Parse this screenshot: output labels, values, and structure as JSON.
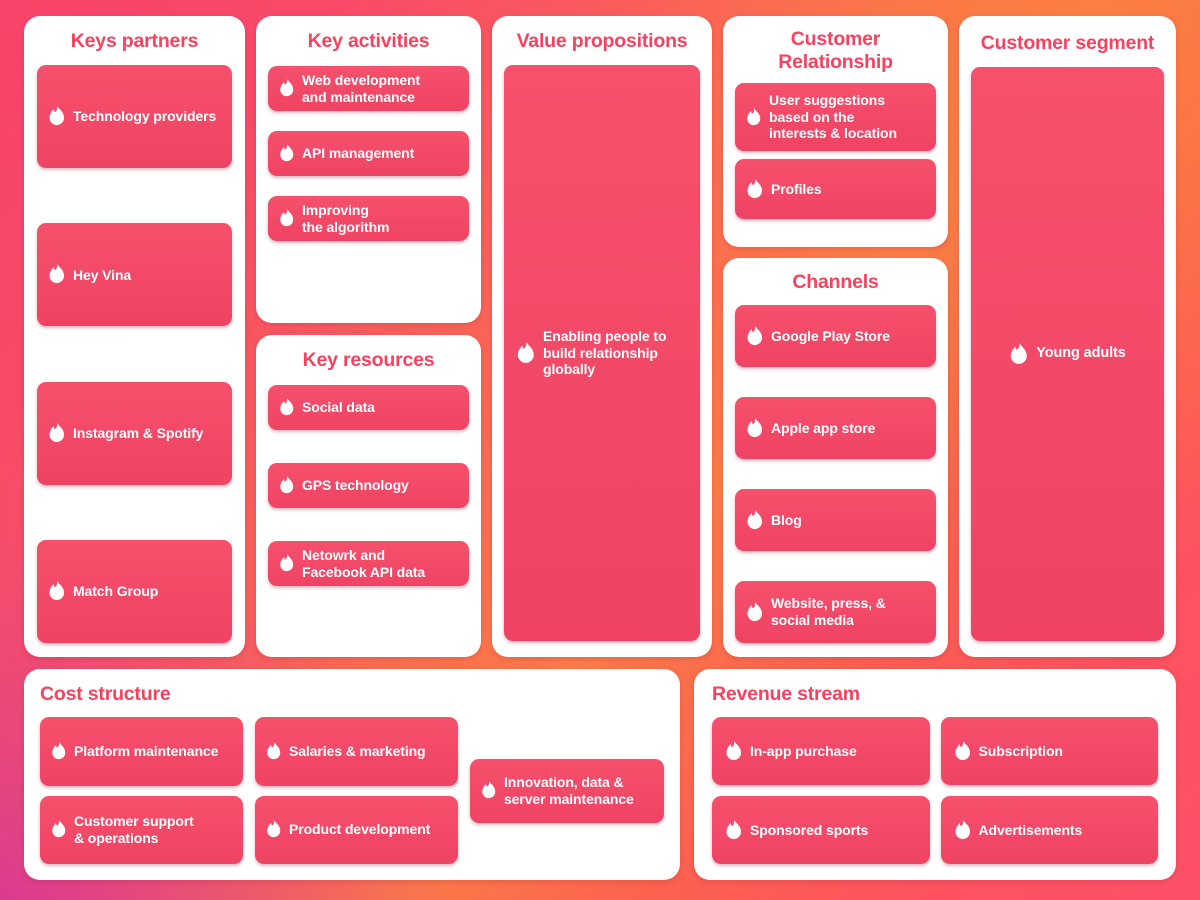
{
  "theme": {
    "background_gradient": [
      "#F9436B",
      "#FB7A48",
      "#FD5068",
      "#D83696"
    ],
    "panel_background": "#FFFFFF",
    "card_fill": "#F24B68",
    "title_color": "#F7415F",
    "card_text_color": "#FFFFFF",
    "icon": "tinder-flame-icon"
  },
  "blocks": {
    "keys_partners": {
      "title": "Keys partners",
      "items": [
        {
          "label": "Technology providers"
        },
        {
          "label": "Hey Vina"
        },
        {
          "label": "Instagram & Spotify"
        },
        {
          "label": "Match Group"
        }
      ]
    },
    "key_activities": {
      "title": "Key activities",
      "items": [
        {
          "label": "Web development\nand maintenance"
        },
        {
          "label": "API management"
        },
        {
          "label": "Improving\nthe algorithm"
        }
      ]
    },
    "key_resources": {
      "title": "Key resources",
      "items": [
        {
          "label": "Social data"
        },
        {
          "label": "GPS technology"
        },
        {
          "label": "Netowrk and\nFacebook API data"
        }
      ]
    },
    "value_propositions": {
      "title": "Value propositions",
      "items": [
        {
          "label": "Enabling people to\nbuild relationship\nglobally"
        }
      ]
    },
    "customer_relationship": {
      "title": "Customer\nRelationship",
      "items": [
        {
          "label": "User suggestions\nbased on the\ninterests & location"
        },
        {
          "label": "Profiles"
        }
      ]
    },
    "channels": {
      "title": "Channels",
      "items": [
        {
          "label": "Google Play Store"
        },
        {
          "label": "Apple app store"
        },
        {
          "label": "Blog"
        },
        {
          "label": "Website, press, &\nsocial media"
        }
      ]
    },
    "customer_segment": {
      "title": "Customer segment",
      "items": [
        {
          "label": "Young adults"
        }
      ]
    },
    "cost_structure": {
      "title": "Cost structure",
      "column_one": [
        {
          "label": "Platform maintenance"
        },
        {
          "label": "Customer support\n& operations"
        }
      ],
      "column_two": [
        {
          "label": "Salaries & marketing"
        },
        {
          "label": "Product development"
        }
      ],
      "column_three": [
        {
          "label": "Innovation, data &\nserver maintenance"
        }
      ]
    },
    "revenue_stream": {
      "title": "Revenue stream",
      "items": [
        {
          "label": "In-app purchase"
        },
        {
          "label": "Subscription"
        },
        {
          "label": "Sponsored sports"
        },
        {
          "label": "Advertisements"
        }
      ]
    }
  }
}
